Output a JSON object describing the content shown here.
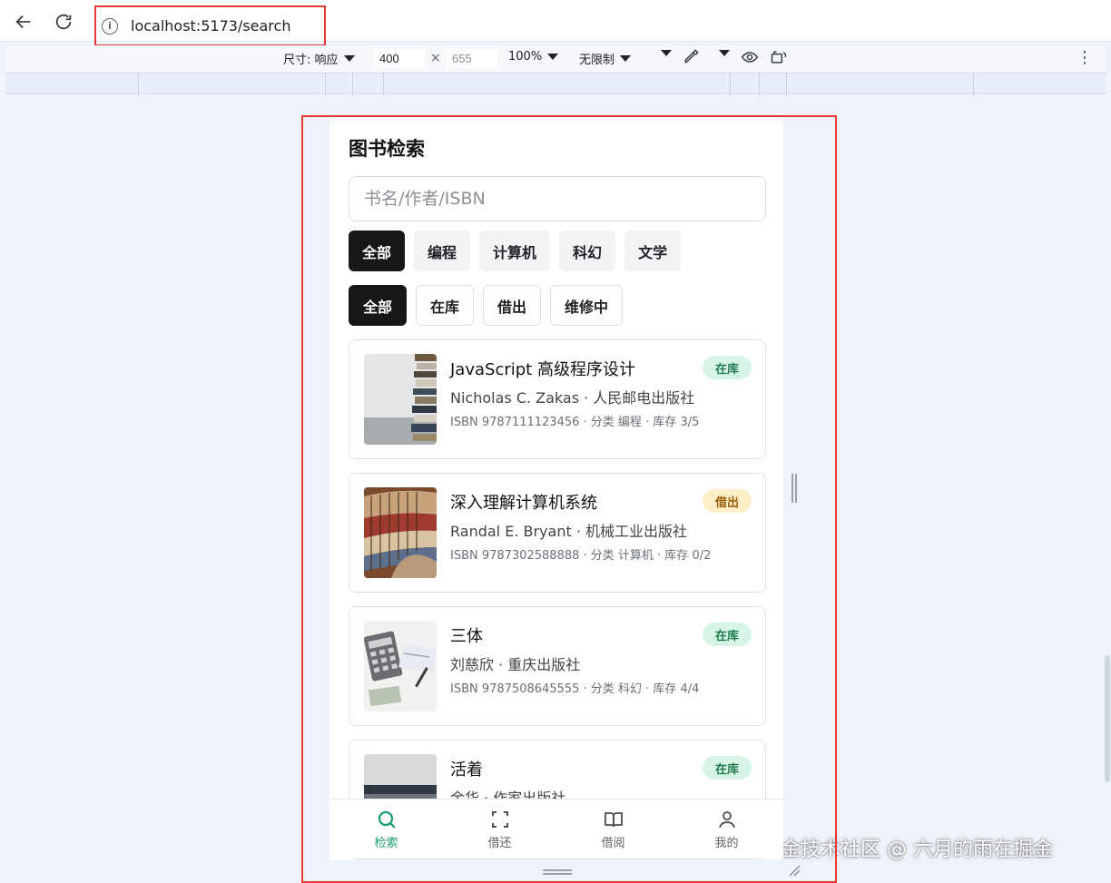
{
  "browser": {
    "url": "localhost:5173/search"
  },
  "devtools": {
    "size_label": "尺寸: 响应",
    "width": "400",
    "height": "655",
    "times": "×",
    "zoom": "100%",
    "throttle": "无限制"
  },
  "page": {
    "title": "图书检索",
    "search_placeholder": "书名/作者/ISBN",
    "categories": [
      "全部",
      "编程",
      "计算机",
      "科幻",
      "文学"
    ],
    "statuses": [
      "全部",
      "在库",
      "借出",
      "维修中"
    ],
    "active_category": "全部",
    "active_status": "全部"
  },
  "books": [
    {
      "title": "JavaScript 高级程序设计",
      "author_publisher": "Nicholas C. Zakas · 人民邮电出版社",
      "meta": "ISBN 9787111123456 · 分类 编程 · 库存 3/5",
      "status": "在库"
    },
    {
      "title": "深入理解计算机系统",
      "author_publisher": "Randal E. Bryant · 机械工业出版社",
      "meta": "ISBN 9787302588888 · 分类 计算机 · 库存 0/2",
      "status": "借出"
    },
    {
      "title": "三体",
      "author_publisher": "刘慈欣 · 重庆出版社",
      "meta": "ISBN 9787508645555 · 分类 科幻 · 库存 4/4",
      "status": "在库"
    },
    {
      "title": "活着",
      "author_publisher": "余华 · 作家出版社",
      "meta": "",
      "status": "在库"
    }
  ],
  "tabbar": {
    "items": [
      "检索",
      "借还",
      "借阅",
      "我的"
    ],
    "icons": [
      "search-icon",
      "scan-icon",
      "book-open-icon",
      "user-icon"
    ],
    "active": "检索"
  },
  "colors": {
    "accent_green": "#18a06b",
    "chip_active": "#171717",
    "badge_in_bg": "#d7f5e6",
    "badge_out_bg": "#fdeec7",
    "annotation_red": "#e53935"
  },
  "watermark": "掘金技术社区 @ 六月的雨在掘金"
}
